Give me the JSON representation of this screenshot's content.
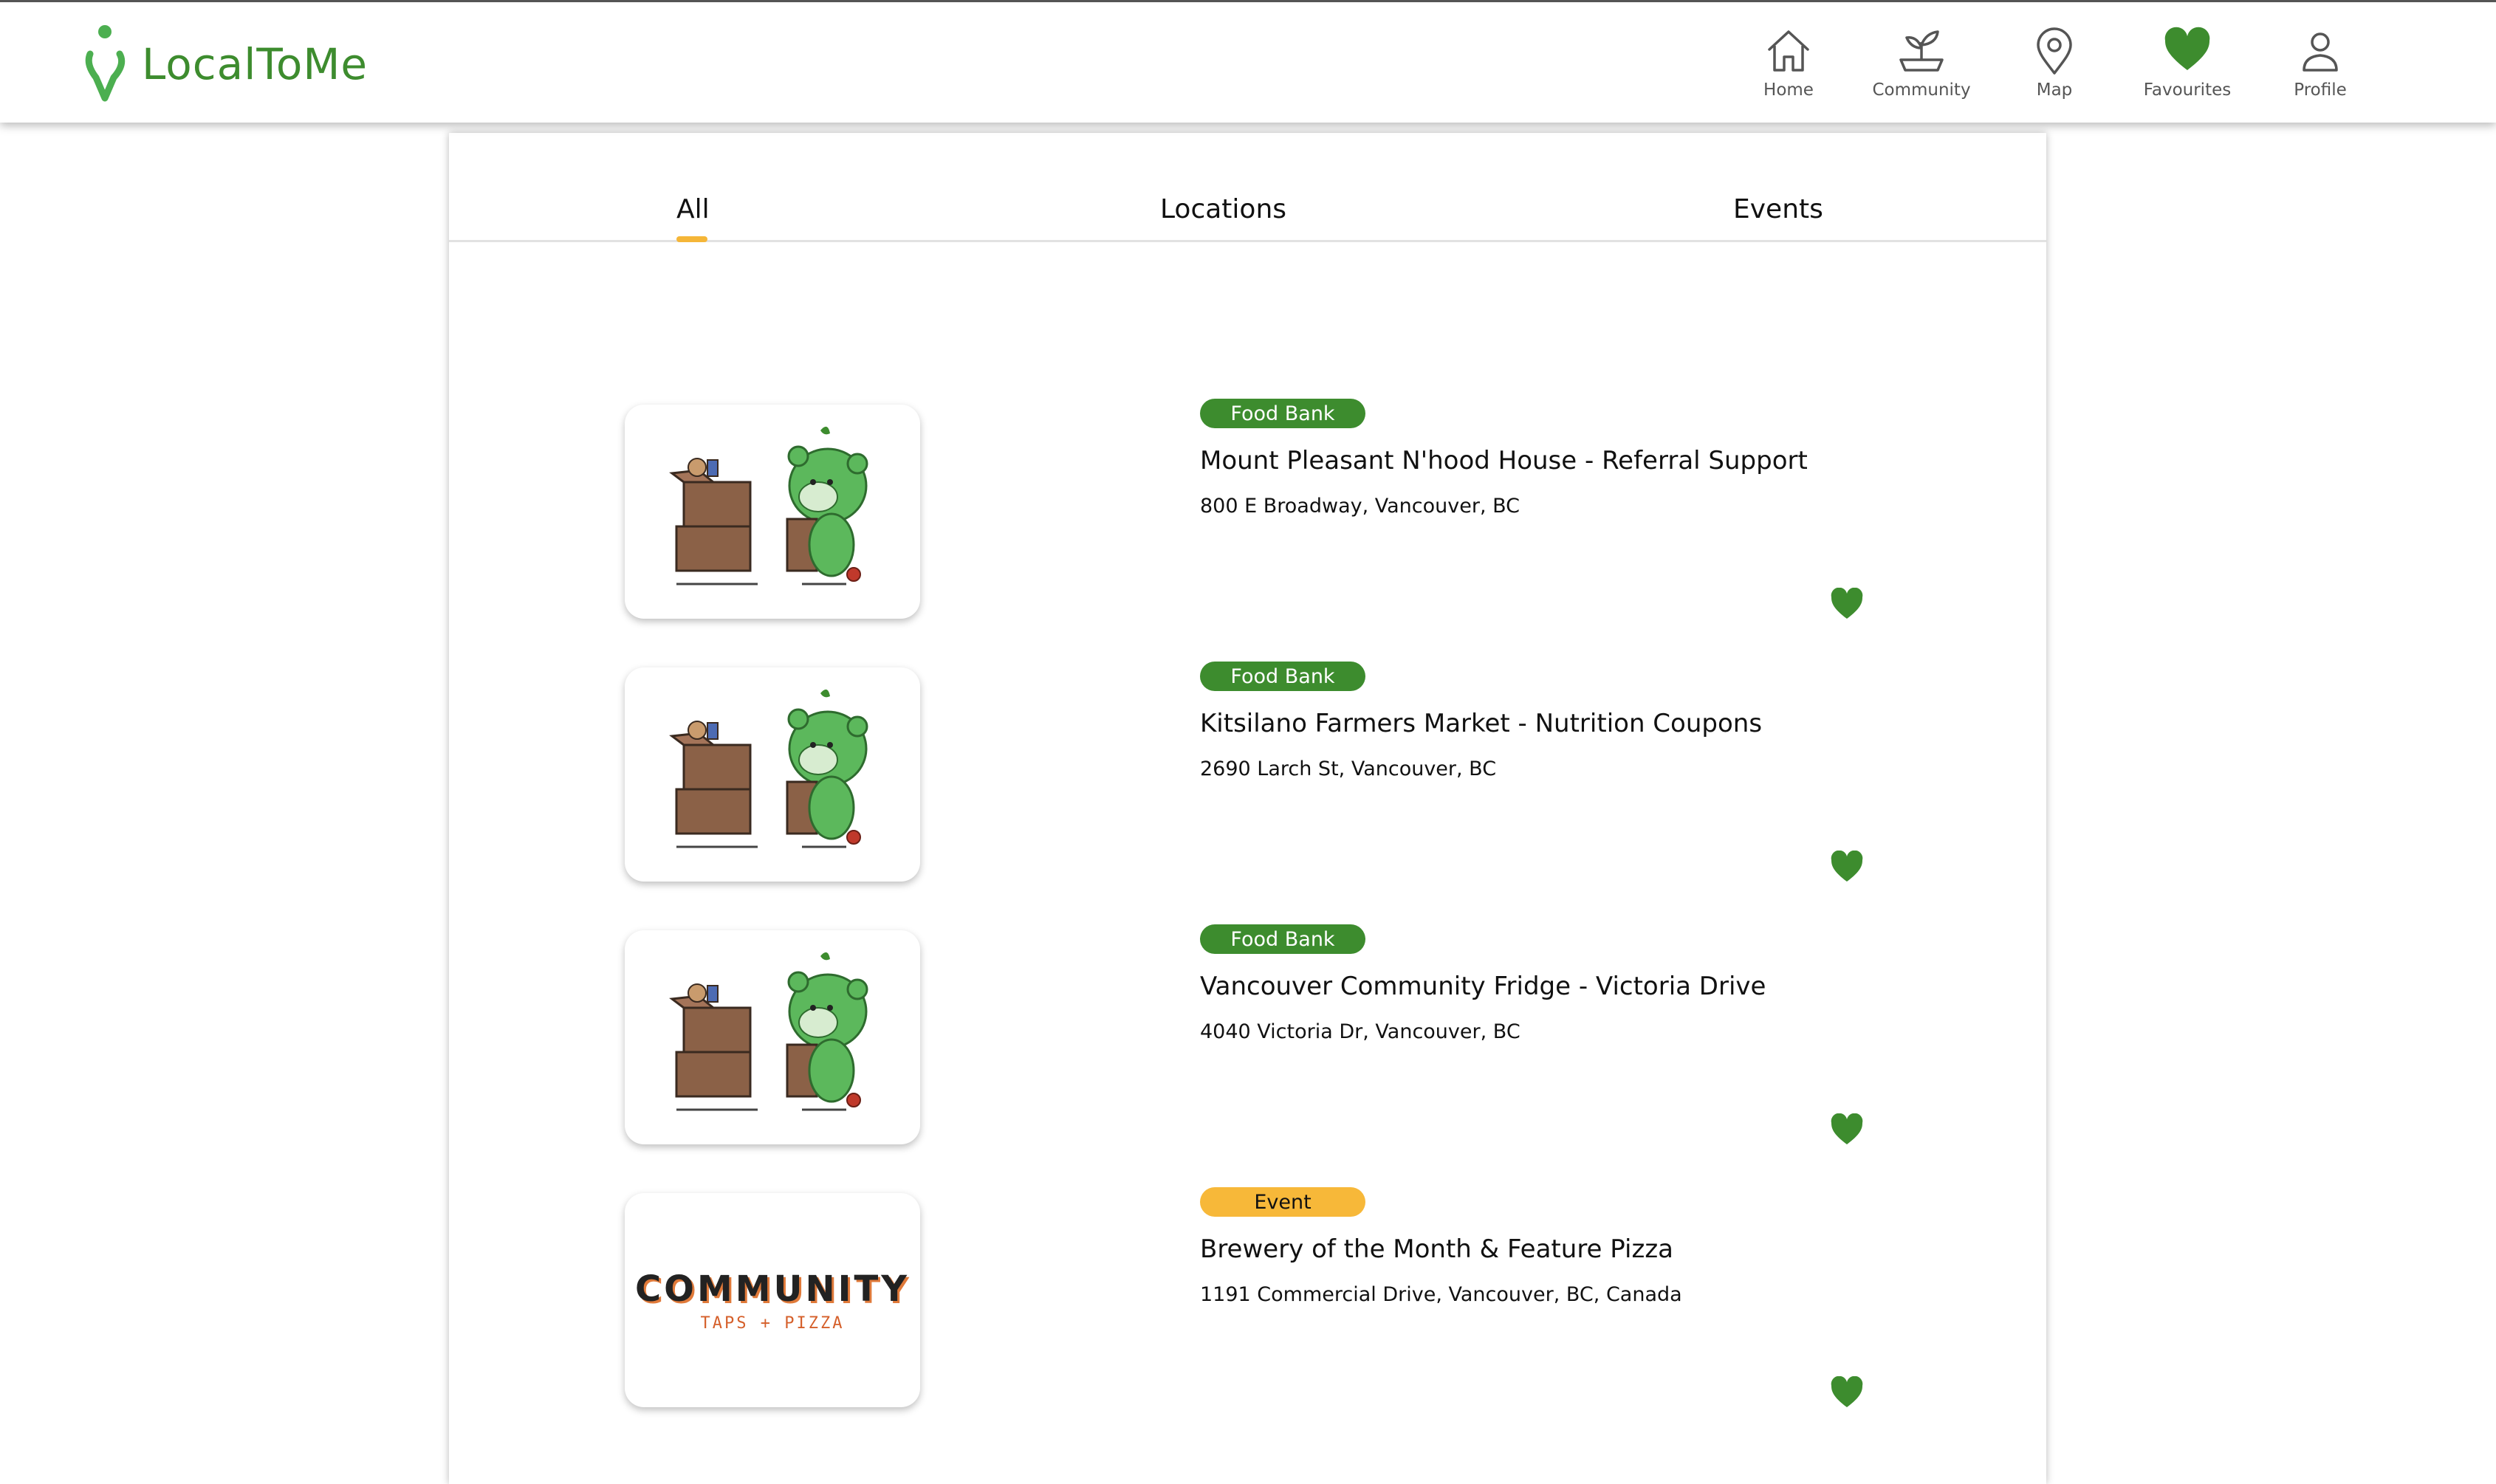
{
  "app": {
    "name": "LocalToMe",
    "brand_color": "#3d8c2e",
    "accent_color": "#f5b638"
  },
  "nav": [
    {
      "label": "Home",
      "icon": "home-icon"
    },
    {
      "label": "Community",
      "icon": "sprout-icon"
    },
    {
      "label": "Map",
      "icon": "map-pin-icon"
    },
    {
      "label": "Favourites",
      "icon": "heart-icon",
      "active": true
    },
    {
      "label": "Profile",
      "icon": "person-icon"
    }
  ],
  "tabs": [
    {
      "label": "All",
      "selected": true
    },
    {
      "label": "Locations",
      "selected": false
    },
    {
      "label": "Events",
      "selected": false
    }
  ],
  "items": [
    {
      "badge": "Food Bank",
      "badge_type": "foodbank",
      "title": "Mount Pleasant N'hood House - Referral Support",
      "address": "800 E Broadway, Vancouver, BC",
      "thumbnail": "food-bank-mascot",
      "favourited": true
    },
    {
      "badge": "Food Bank",
      "badge_type": "foodbank",
      "title": "Kitsilano Farmers Market - Nutrition Coupons",
      "address": "2690 Larch St, Vancouver, BC",
      "thumbnail": "food-bank-mascot",
      "favourited": true
    },
    {
      "badge": "Food Bank",
      "badge_type": "foodbank",
      "title": "Vancouver Community Fridge - Victoria Drive",
      "address": "4040 Victoria Dr, Vancouver, BC",
      "thumbnail": "food-bank-mascot",
      "favourited": true
    },
    {
      "badge": "Event",
      "badge_type": "event",
      "title": "Brewery of the Month & Feature Pizza",
      "address": "1191 Commercial Drive, Vancouver, BC, Canada",
      "thumbnail": "community-taps-pizza-logo",
      "thumbnail_text": {
        "main": "COMMUNITY",
        "sub": "TAPS + PIZZA"
      },
      "favourited": true
    }
  ]
}
